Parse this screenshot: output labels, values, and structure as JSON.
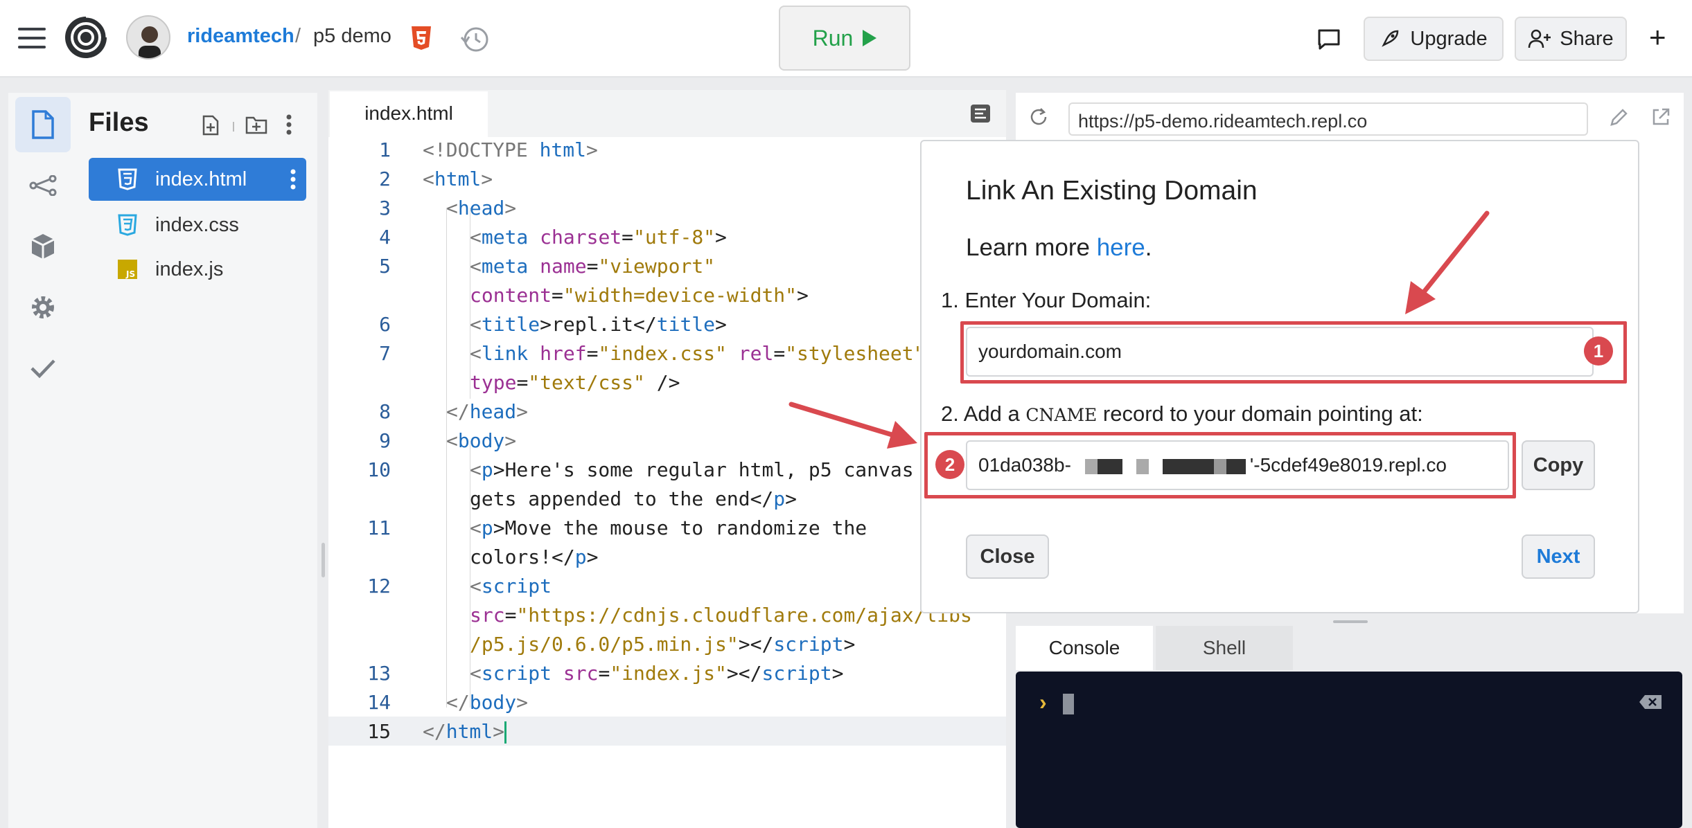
{
  "header": {
    "username": "rideamtech",
    "separator": "/",
    "project": "p5 demo",
    "run_label": "Run",
    "upgrade_label": "Upgrade",
    "share_label": "Share",
    "plus_label": "+"
  },
  "files": {
    "title": "Files",
    "items": [
      {
        "label": "index.html",
        "icon": "html5-icon"
      },
      {
        "label": "index.css",
        "icon": "css3-icon"
      },
      {
        "label": "index.js",
        "icon": "js-icon"
      }
    ]
  },
  "editor": {
    "tab": "index.html",
    "line_numbers": [
      "1",
      "2",
      "3",
      "4",
      "5",
      "6",
      "7",
      "8",
      "9",
      "10",
      "11",
      "12",
      "13",
      "14",
      "15"
    ]
  },
  "preview": {
    "url": "https://p5-demo.rideamtech.repl.co"
  },
  "console": {
    "tabs": [
      "Console",
      "Shell"
    ],
    "prompt": "›"
  },
  "modal": {
    "title": "Link An Existing Domain",
    "learn_prefix": "Learn more ",
    "learn_link": "here",
    "learn_suffix": ".",
    "step1_label": "1. Enter Your Domain:",
    "domain_placeholder": "yourdomain.com",
    "step2_prefix": "2. Add a ",
    "step2_mono": "CNAME",
    "step2_suffix": " record to your domain pointing at:",
    "cname_start": "01da038b-",
    "cname_end": "'-5cdef49e8019.repl.co",
    "copy_label": "Copy",
    "close_label": "Close",
    "next_label": "Next",
    "badge1": "1",
    "badge2": "2"
  },
  "colors": {
    "accent_blue": "#2f7cd7",
    "run_green": "#23a14a",
    "annotation_red": "#d9494f",
    "console_bg": "#0d1224"
  }
}
